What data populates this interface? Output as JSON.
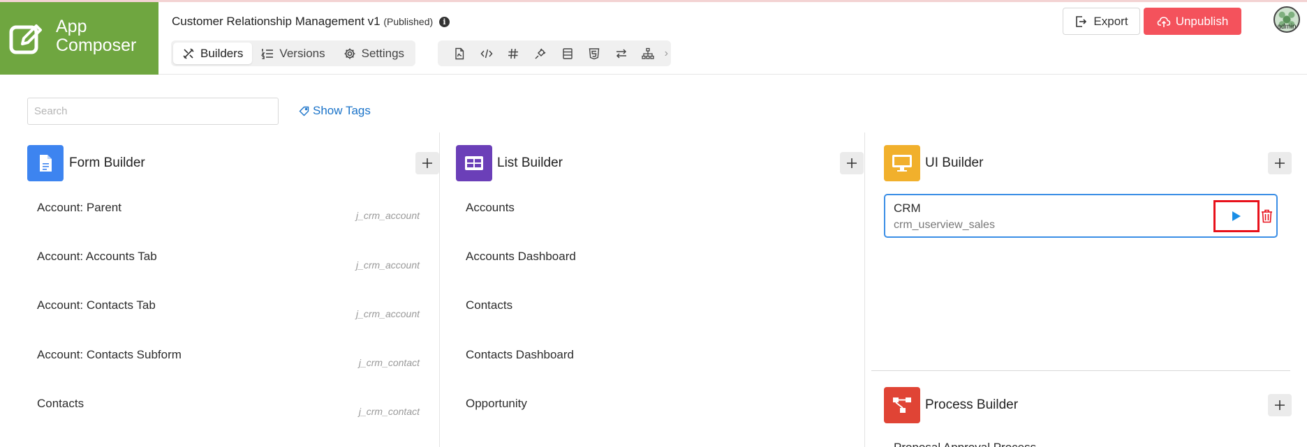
{
  "app": {
    "logo_text_line1": "App",
    "logo_text_line2": "Composer",
    "title": "Customer Relationship Management v1",
    "status": "(Published)"
  },
  "tabs": [
    {
      "label": "Builders",
      "icon": "builders-icon",
      "active": true
    },
    {
      "label": "Versions",
      "icon": "list-numbered-icon",
      "active": false
    },
    {
      "label": "Settings",
      "icon": "gear-icon",
      "active": false
    }
  ],
  "toolbar_icons": [
    "pdf-file-icon",
    "code-icon",
    "hash-icon",
    "plugin-icon",
    "form-icon",
    "html5-icon",
    "swap-arrows-icon",
    "sitemap-icon",
    "chevron-right-icon"
  ],
  "actions": {
    "export_label": "Export",
    "unpublish_label": "Unpublish"
  },
  "user": {
    "avatar_label": "admin"
  },
  "search": {
    "placeholder": "Search",
    "value": ""
  },
  "show_tags_label": "Show Tags",
  "form_builder": {
    "title": "Form Builder",
    "color": "#3d84f0",
    "items": [
      {
        "name": "Account: Parent",
        "tag": "j_crm_account"
      },
      {
        "name": "Account: Accounts Tab",
        "tag": "j_crm_account"
      },
      {
        "name": "Account: Contacts Tab",
        "tag": "j_crm_account"
      },
      {
        "name": "Account: Contacts Subform",
        "tag": "j_crm_contact"
      },
      {
        "name": "Contacts",
        "tag": "j_crm_contact"
      }
    ]
  },
  "list_builder": {
    "title": "List Builder",
    "color": "#6b3fb8",
    "items": [
      {
        "name": "Accounts"
      },
      {
        "name": "Accounts Dashboard"
      },
      {
        "name": "Contacts"
      },
      {
        "name": "Contacts Dashboard"
      },
      {
        "name": "Opportunity"
      }
    ]
  },
  "ui_builder": {
    "title": "UI Builder",
    "color": "#f1b02c",
    "items": [
      {
        "name": "CRM",
        "id": "crm_userview_sales"
      }
    ]
  },
  "process_builder": {
    "title": "Process Builder",
    "color": "#e04435",
    "partial_item": "Proposal Approval Process"
  },
  "colors": {
    "logo_bg": "#6fa640",
    "unpublish_bg": "#f4525c",
    "link": "#1a73c9",
    "selected_border": "#3a8ee6",
    "highlight_box": "#e8111b",
    "play": "#1a8ee6",
    "trash": "#e8111b"
  }
}
